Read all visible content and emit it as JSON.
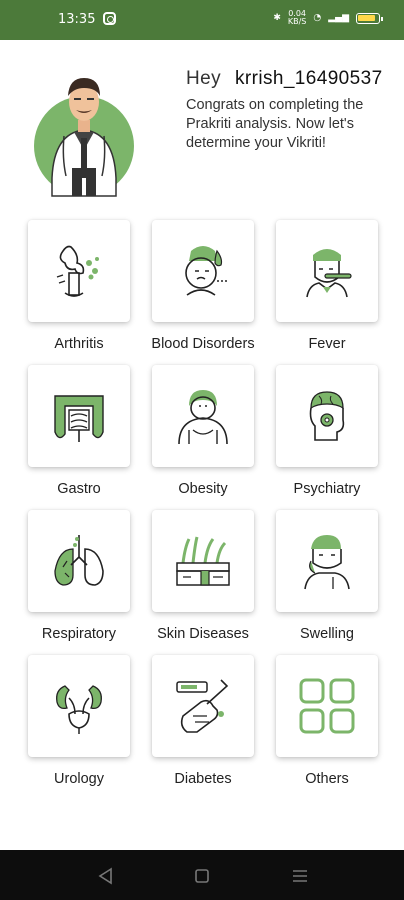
{
  "status_bar": {
    "time": "13:35",
    "net_speed": "0.04",
    "net_unit": "KB/S"
  },
  "header": {
    "greeting": "Hey",
    "username": "krrish_16490537",
    "message": "Congrats on completing the Prakriti analysis. Now let's determine your Vikriti!"
  },
  "categories": [
    {
      "label": "Arthritis",
      "icon": "joint-icon"
    },
    {
      "label": "Blood Disorders",
      "icon": "blood-drop-icon"
    },
    {
      "label": "Fever",
      "icon": "thermometer-icon"
    },
    {
      "label": "Gastro",
      "icon": "intestine-icon"
    },
    {
      "label": "Obesity",
      "icon": "obesity-icon"
    },
    {
      "label": "Psychiatry",
      "icon": "brain-head-icon"
    },
    {
      "label": "Respiratory",
      "icon": "lungs-icon"
    },
    {
      "label": "Skin Diseases",
      "icon": "skin-icon"
    },
    {
      "label": "Swelling",
      "icon": "swollen-face-icon"
    },
    {
      "label": "Urology",
      "icon": "kidneys-icon"
    },
    {
      "label": "Diabetes",
      "icon": "glucose-meter-icon"
    },
    {
      "label": "Others",
      "icon": "grid-icon"
    }
  ],
  "colors": {
    "accent": "#7cb56a",
    "status_bar": "#4c7a3a",
    "nav_bar": "#0d0d0d"
  }
}
